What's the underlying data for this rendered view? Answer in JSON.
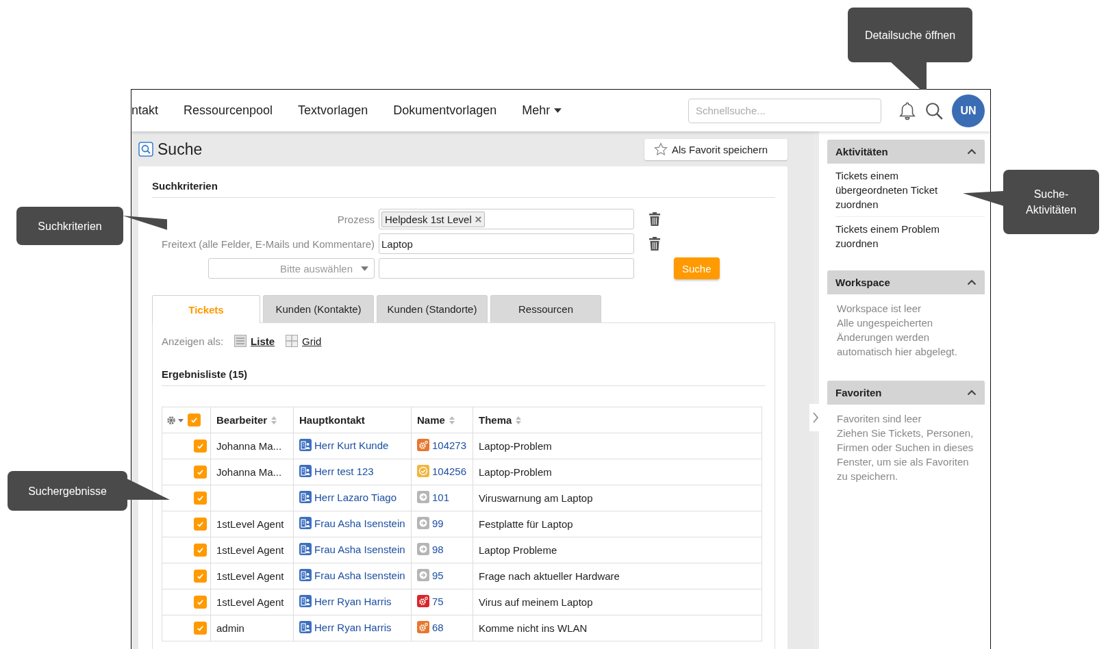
{
  "callouts": [
    {
      "text": "Detailsuche öffnen"
    },
    {
      "text": "Suchkriterien"
    },
    {
      "text": "Suchergebnisse"
    },
    {
      "text": "Suche-\nAktivitäten"
    }
  ],
  "nav": {
    "items": [
      "ntakt",
      "Ressourcenpool",
      "Textvorlagen",
      "Dokumentvorlagen"
    ],
    "more": "Mehr",
    "search_placeholder": "Schnellsuche...",
    "avatar": "UN"
  },
  "page": {
    "title": "Suche",
    "favorite_button": "Als Favorit speichern"
  },
  "criteria": {
    "heading": "Suchkriterien",
    "fields": [
      {
        "kind": "tags",
        "label": "Prozess",
        "tags": [
          "Helpdesk 1st Level"
        ]
      },
      {
        "kind": "text",
        "label": "Freitext (alle Felder, E-Mails und Kommentare)",
        "value": "Laptop"
      }
    ],
    "select_placeholder": "Bitte auswählen",
    "search_button": "Suche"
  },
  "tabs": [
    {
      "label": "Tickets",
      "selected": true
    },
    {
      "label": "Kunden (Kontakte)",
      "selected": false
    },
    {
      "label": "Kunden (Standorte)",
      "selected": false
    },
    {
      "label": "Ressourcen",
      "selected": false
    }
  ],
  "view": {
    "label": "Anzeigen als:",
    "options": [
      {
        "label": "Liste",
        "selected": true
      },
      {
        "label": "Grid",
        "selected": false
      }
    ]
  },
  "results": {
    "heading": "Ergebnisliste (15)",
    "all_checked": true,
    "columns": [
      {
        "label": "Bearbeiter",
        "sortable": true
      },
      {
        "label": "Hauptkontakt",
        "sortable": false
      },
      {
        "label": "Name",
        "sortable": true
      },
      {
        "label": "Thema",
        "sortable": true
      }
    ],
    "rows": [
      {
        "checked": true,
        "agent": "Johanna Ma...",
        "contact": "Herr Kurt Kunde",
        "kind": "gear",
        "color": "#e8772e",
        "name": "104273",
        "topic": "Laptop-Problem"
      },
      {
        "checked": true,
        "agent": "Johanna Ma...",
        "contact": "Herr test 123",
        "kind": "check",
        "color": "#f0b640",
        "name": "104256",
        "topic": "Laptop-Problem"
      },
      {
        "checked": true,
        "contact": "Herr Lazaro Tiago",
        "kind": "arrow",
        "color": "#b5b5b5",
        "name": "101",
        "topic": "Viruswarnung am Laptop"
      },
      {
        "checked": true,
        "agent": "1stLevel Agent",
        "contact": "Frau Asha Isenstein",
        "kind": "arrow",
        "color": "#b5b5b5",
        "name": "99",
        "topic": "Festplatte für Laptop"
      },
      {
        "checked": true,
        "agent": "1stLevel Agent",
        "contact": "Frau Asha Isenstein",
        "kind": "arrow",
        "color": "#b5b5b5",
        "name": "98",
        "topic": "Laptop Probleme"
      },
      {
        "checked": true,
        "agent": "1stLevel Agent",
        "contact": "Frau Asha Isenstein",
        "kind": "arrow",
        "color": "#b5b5b5",
        "name": "95",
        "topic": "Frage nach aktueller Hardware"
      },
      {
        "checked": true,
        "agent": "1stLevel Agent",
        "contact": "Herr Ryan Harris",
        "kind": "gear",
        "color": "#d9262a",
        "name": "75",
        "topic": "Virus auf meinem Laptop"
      },
      {
        "checked": true,
        "agent": "admin",
        "contact": "Herr Ryan Harris",
        "kind": "gear",
        "color": "#e8772e",
        "name": "68",
        "topic": "Komme nicht ins WLAN"
      }
    ]
  },
  "sidebar": [
    {
      "title": "Aktivitäten",
      "expanded": true,
      "kind": "links",
      "items": [
        "Tickets einem übergeordneten Ticket zuordnen",
        "Tickets einem Problem zuordnen"
      ]
    },
    {
      "title": "Workspace",
      "expanded": true,
      "kind": "note",
      "items": [
        "Workspace ist leer",
        "Alle ungespeicherten Änderungen werden automatisch hier abgelegt."
      ]
    },
    {
      "title": "Favoriten",
      "expanded": true,
      "kind": "note",
      "items": [
        "Favoriten sind leer",
        "Ziehen Sie Tickets, Personen, Firmen oder Suchen in dieses Fenster, um sie als Favoriten zu speichern."
      ]
    }
  ]
}
